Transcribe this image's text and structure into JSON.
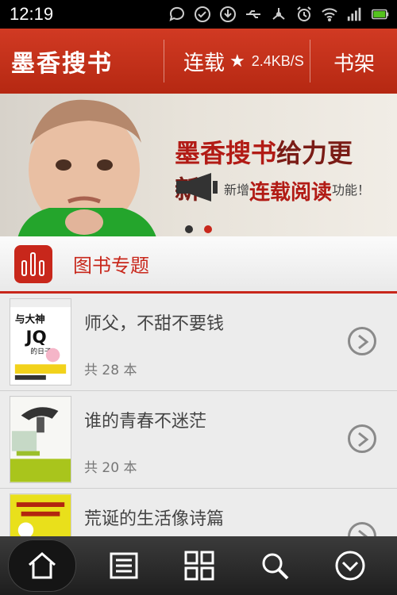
{
  "status_bar": {
    "time": "12:19",
    "icons": [
      "chat-icon",
      "check-icon",
      "download-icon",
      "usb-icon",
      "share-icon",
      "alarm-icon",
      "wifi-icon",
      "signal-icon",
      "battery-icon"
    ]
  },
  "app_bar": {
    "logo": "墨香搜书",
    "nav_serial": "连载",
    "star": "★",
    "speed": "2.4KB/S",
    "nav_shelf": "书架"
  },
  "banner": {
    "title_prefix": "墨香搜书",
    "title_suffix": "给力更新！",
    "sub_prefix": "新增",
    "sub_highlight": "连载阅读",
    "sub_suffix": "功能！",
    "dots": 2,
    "active_dot": 1
  },
  "section": {
    "title": "图书专题"
  },
  "books": [
    {
      "title": "师父，不甜不要钱",
      "count": "共 28 本"
    },
    {
      "title": "谁的青春不迷茫",
      "count": "共 20 本"
    },
    {
      "title": "荒诞的生活像诗篇",
      "count": ""
    }
  ],
  "bottom_nav": {
    "items": [
      "home-icon",
      "list-icon",
      "grid-icon",
      "search-icon",
      "more-icon"
    ],
    "active": 0
  },
  "colors": {
    "brand": "#c8271b",
    "header": "#c0301a",
    "bottom_bar": "#2a2a2a"
  }
}
